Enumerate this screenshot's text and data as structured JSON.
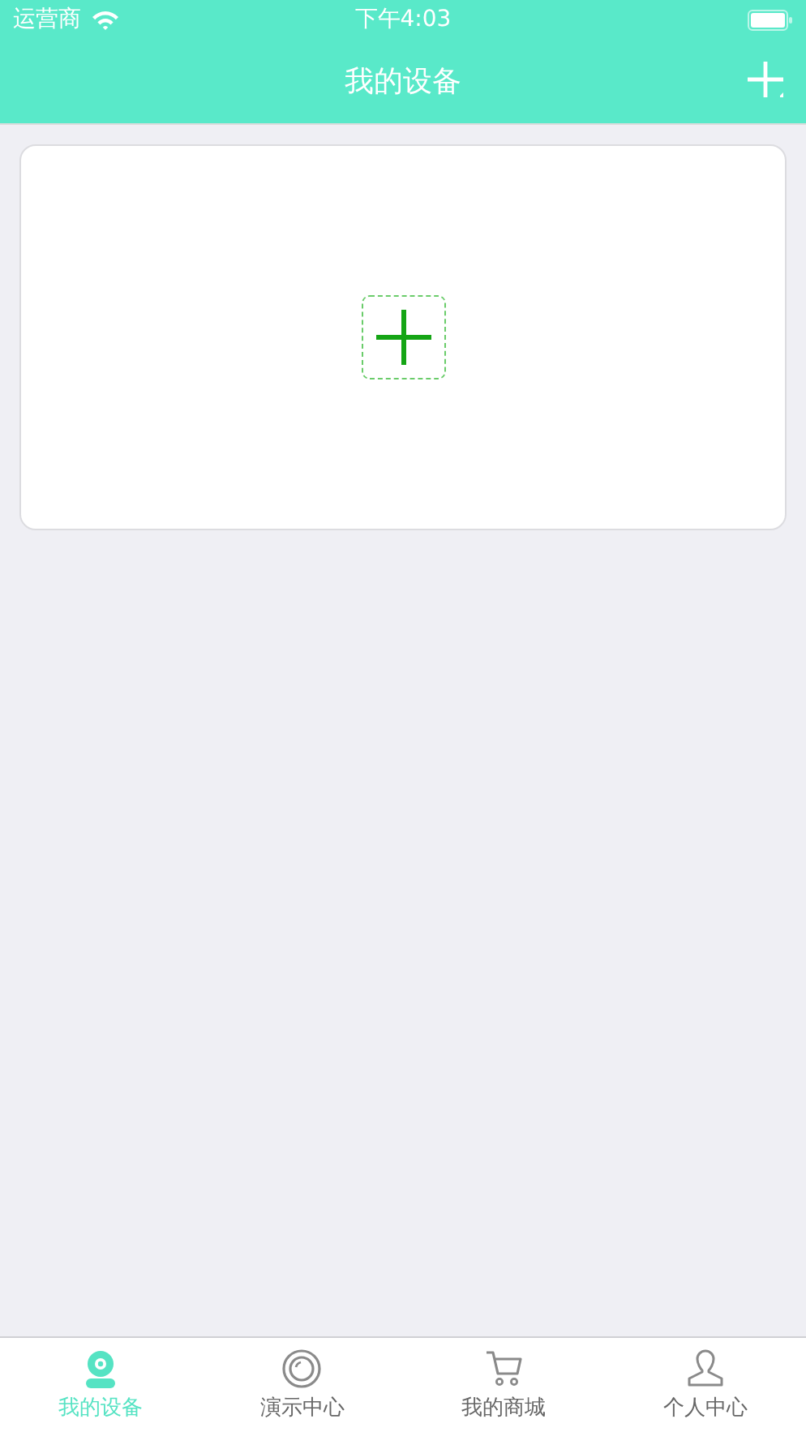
{
  "status_bar": {
    "carrier": "运营商",
    "time": "下午4:03"
  },
  "nav_bar": {
    "title": "我的设备"
  },
  "tabs": [
    {
      "label": "我的设备",
      "kind": "camera",
      "selected": true
    },
    {
      "label": "演示中心",
      "kind": "lens",
      "selected": false
    },
    {
      "label": "我的商城",
      "kind": "cart",
      "selected": false
    },
    {
      "label": "个人中心",
      "kind": "person",
      "selected": false
    }
  ]
}
